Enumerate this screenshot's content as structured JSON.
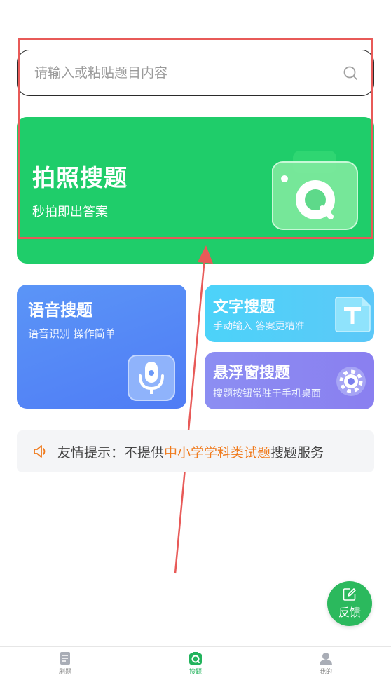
{
  "search": {
    "placeholder": "请输入或粘贴题目内容",
    "value": ""
  },
  "photo_card": {
    "title": "拍照搜题",
    "subtitle": "秒拍即出答案"
  },
  "voice_card": {
    "title": "语音搜题",
    "subtitle": "语音识别 操作简单"
  },
  "text_card": {
    "title": "文字搜题",
    "subtitle": "手动输入 答案更精准"
  },
  "float_card": {
    "title": "悬浮窗搜题",
    "subtitle": "搜题按钮常驻于手机桌面"
  },
  "tip": {
    "prefix": "友情提示：不提供",
    "highlight": "中小学学科类试题",
    "suffix": "搜题服务"
  },
  "feedback": {
    "label": "反馈"
  },
  "tabs": [
    {
      "label": "刷题",
      "icon": "document-icon",
      "active": false
    },
    {
      "label": "搜题",
      "icon": "camera-search-icon",
      "active": true
    },
    {
      "label": "我的",
      "icon": "user-icon",
      "active": false
    }
  ],
  "colors": {
    "primary_green": "#1fcd6a",
    "voice_blue": "#5588f6",
    "text_cyan": "#4fd0f9",
    "float_purple": "#8b87f1",
    "tip_orange": "#f07a1c",
    "annotation_red": "#e85a58"
  }
}
